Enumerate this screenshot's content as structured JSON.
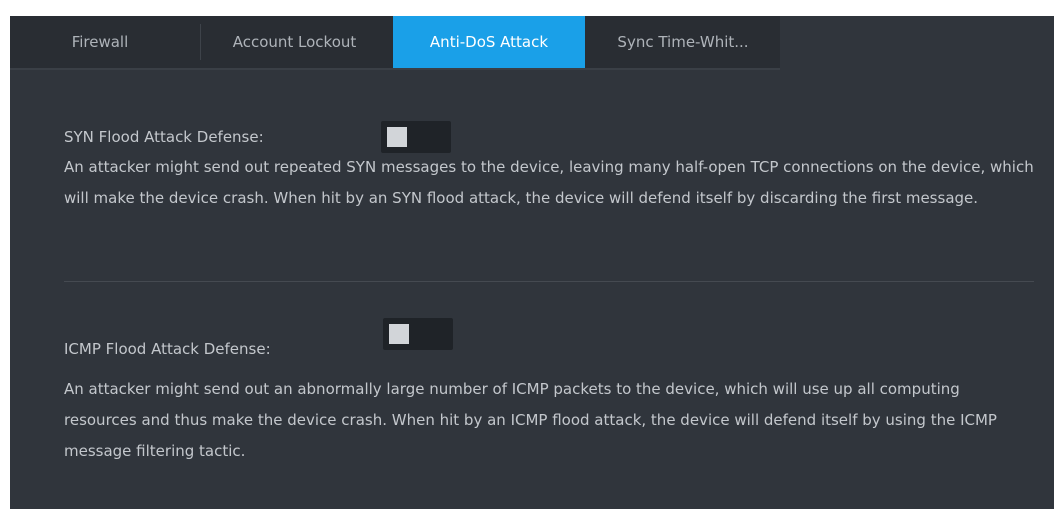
{
  "tabs": [
    {
      "label": "Firewall"
    },
    {
      "label": "Account Lockout"
    },
    {
      "label": "Anti-DoS Attack"
    },
    {
      "label": "Sync Time-Whit..."
    }
  ],
  "active_tab": "Anti-DoS Attack",
  "syn": {
    "label": "SYN Flood Attack Defense:",
    "enabled": false,
    "description": "An attacker might send out repeated SYN messages to the device, leaving many half-open TCP connections on the device, which will make the device crash. When hit by an SYN flood attack, the device will defend itself by discarding the first message."
  },
  "icmp": {
    "label": "ICMP Flood Attack Defense:",
    "enabled": false,
    "description": "An attacker might send out an abnormally large number of ICMP packets to the device, which will use up all computing resources and thus make the device crash. When hit by an ICMP flood attack, the device will defend itself by using the ICMP message filtering tactic."
  },
  "colors": {
    "accent": "#1aa0e8",
    "panel_bg": "#30353c",
    "text": "#c3c7cc"
  }
}
